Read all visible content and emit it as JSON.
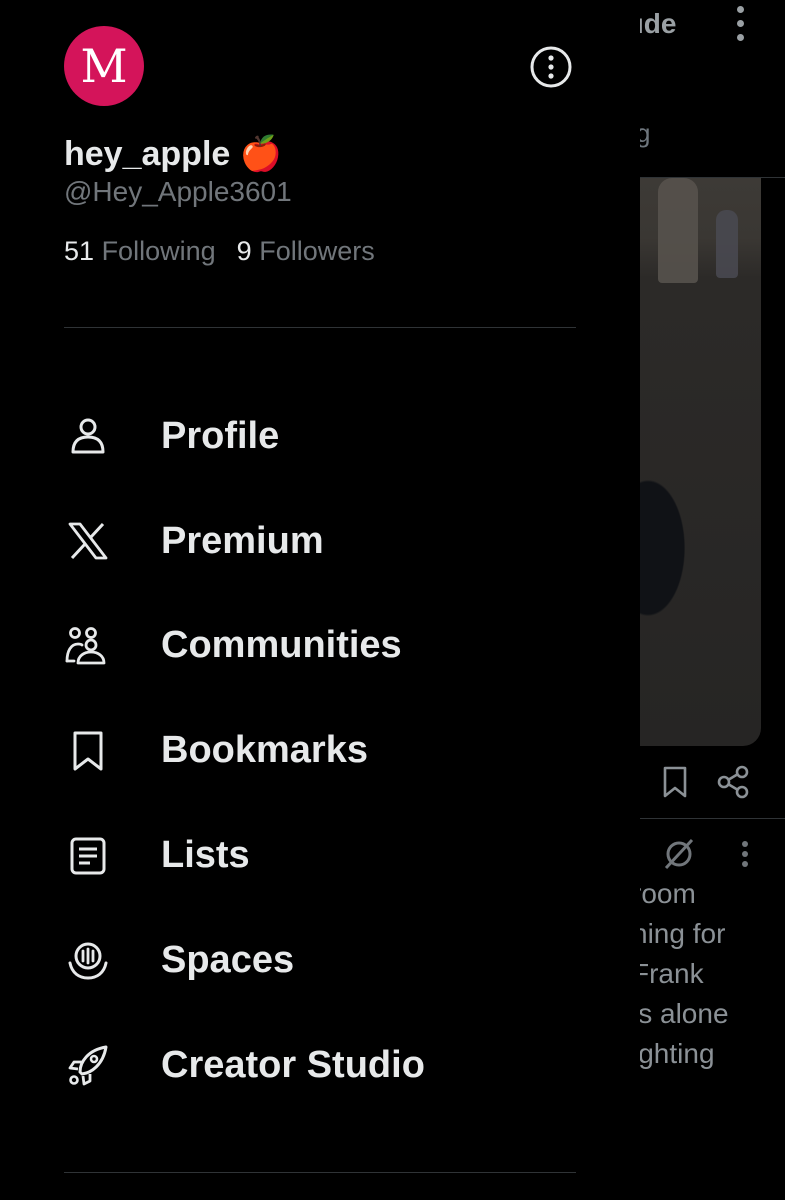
{
  "feed": {
    "header_partial": "ıde",
    "tab_partial": "g",
    "text_lines": [
      "room",
      "ning for",
      "Frank",
      "is alone",
      "ighting"
    ]
  },
  "profile": {
    "avatar_letter": "M",
    "display_name": "hey_apple 🍎",
    "handle": "@Hey_Apple3601",
    "following_count": "51",
    "following_label": "Following",
    "followers_count": "9",
    "followers_label": "Followers"
  },
  "menu": {
    "items": [
      {
        "label": "Profile",
        "icon": "person-icon"
      },
      {
        "label": "Premium",
        "icon": "x-logo-icon"
      },
      {
        "label": "Communities",
        "icon": "communities-icon"
      },
      {
        "label": "Bookmarks",
        "icon": "bookmark-icon"
      },
      {
        "label": "Lists",
        "icon": "list-icon"
      },
      {
        "label": "Spaces",
        "icon": "spaces-icon"
      },
      {
        "label": "Creator Studio",
        "icon": "rocket-icon"
      }
    ]
  },
  "colors": {
    "background": "#000000",
    "text_primary": "#e7e9ea",
    "text_secondary": "#71767b",
    "avatar_bg": "#d4145a",
    "divider": "#2f3336"
  }
}
